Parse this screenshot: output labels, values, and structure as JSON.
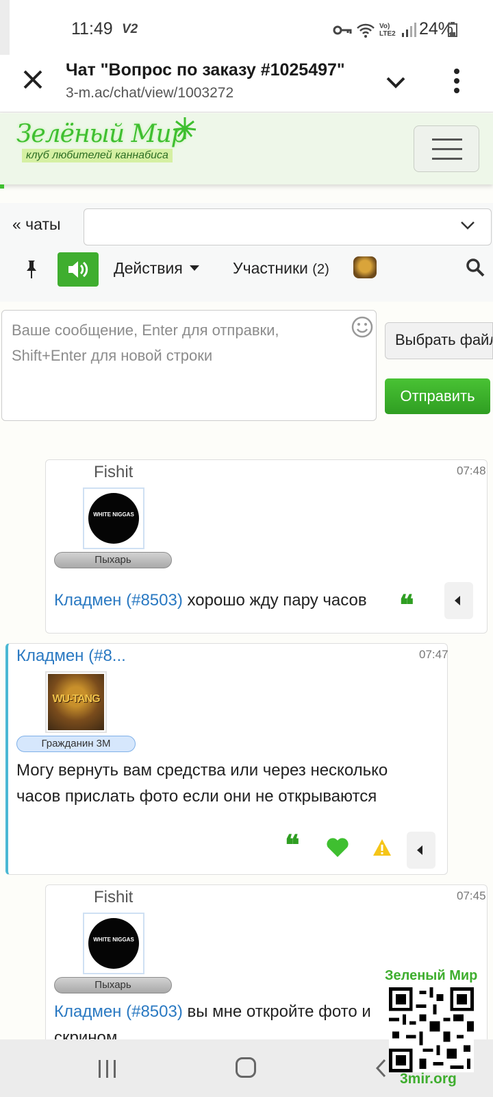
{
  "status_bar": {
    "time": "11:49",
    "network_tag": "V2",
    "volte": "Vo) LTE2",
    "battery": "24%"
  },
  "browser": {
    "title": "Чат \"Вопрос по заказу #1025497\"",
    "url": "3-m.ac/chat/view/1003272"
  },
  "site": {
    "logo_title": "Зелёный Мир",
    "logo_subtitle": "клуб любителей каннабиса"
  },
  "chat_controls": {
    "back_label": "« чаты",
    "chat_select_value": "",
    "actions_label": "Действия",
    "participants_label": "Участники",
    "participants_count": "(2)"
  },
  "composer": {
    "placeholder": "Ваше сообщение, Enter для отправки, Shift+Enter для новой строки",
    "file_button": "Выбрать файл",
    "send_button": "Отправить"
  },
  "messages": [
    {
      "author": "Fishit",
      "time": "07:48",
      "avatar_text": "WHITE NIGGAS",
      "rank": "Пыхарь",
      "mention": "Кладмен (#8503)",
      "text": " хорошо жду пару часов"
    },
    {
      "author": "Кладмен (#8...",
      "time": "07:47",
      "avatar_text": "WU-TANG",
      "rank": "Гражданин 3М",
      "text": "Могу вернуть вам средства или через несколько часов прислать фото если они не открываются"
    },
    {
      "author": "Fishit",
      "time": "07:45",
      "avatar_text": "WHITE NIGGAS",
      "rank": "Пыхарь",
      "mention": "Кладмен (#8503)",
      "text": " вы мне откройте фото и скрином"
    }
  ],
  "watermark": {
    "title": "Зеленый Мир",
    "url": "3mir.org"
  },
  "colors": {
    "brand_green": "#3fae2f",
    "link_blue": "#2a79c2",
    "accent_cyan": "#4bb8d4"
  }
}
